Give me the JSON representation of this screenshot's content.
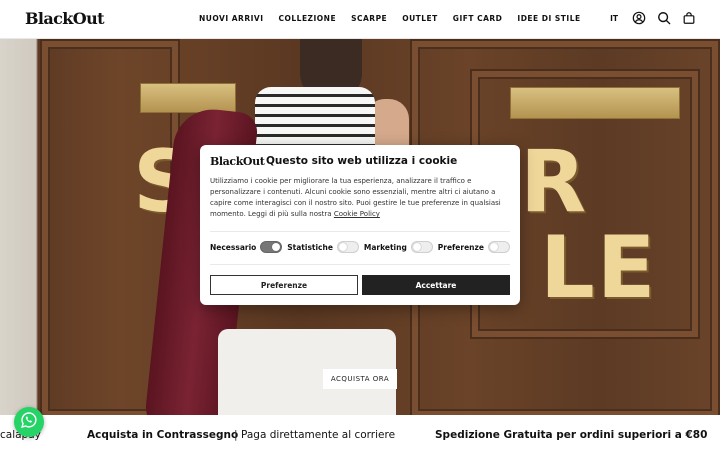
{
  "header": {
    "logo": "BlackOut",
    "nav": [
      "NUOVI ARRIVI",
      "COLLEZIONE",
      "SCARPE",
      "OUTLET",
      "GIFT CARD",
      "IDEE DI STILE"
    ],
    "lang": "IT",
    "icons": [
      "account-icon",
      "search-icon",
      "bag-icon"
    ]
  },
  "hero": {
    "big_left": "S",
    "big_right": "R",
    "big_bottom": "LE",
    "cta": "ACQUISTA ORA"
  },
  "cookie": {
    "logo": "BlackOut",
    "title": "Questo sito web utilizza i cookie",
    "text": "Utilizziamo i cookie per migliorare la tua esperienza, analizzare il traffico e personalizzare i contenuti. Alcuni cookie sono essenziali, mentre altri ci aiutano a capire come interagisci con il nostro sito. Puoi gestire le tue preferenze in qualsiasi momento. Leggi di più sulla nostra",
    "policy_link": "Cookie Policy",
    "toggles": [
      {
        "label": "Necessario",
        "on": true
      },
      {
        "label": "Statistiche",
        "on": false
      },
      {
        "label": "Marketing",
        "on": false
      },
      {
        "label": "Preferenze",
        "on": false
      }
    ],
    "btn_prefs": "Preferenze",
    "btn_accept": "Accettare"
  },
  "banner": {
    "left": "calapay",
    "mid_strong": "Acquista in Contrassegno",
    "mid_rest": "Paga direttamente al corriere",
    "right": "Spedizione Gratuita per ordini superiori a €80"
  },
  "colors": {
    "accent_dark": "#222222",
    "whatsapp": "#25d366"
  }
}
